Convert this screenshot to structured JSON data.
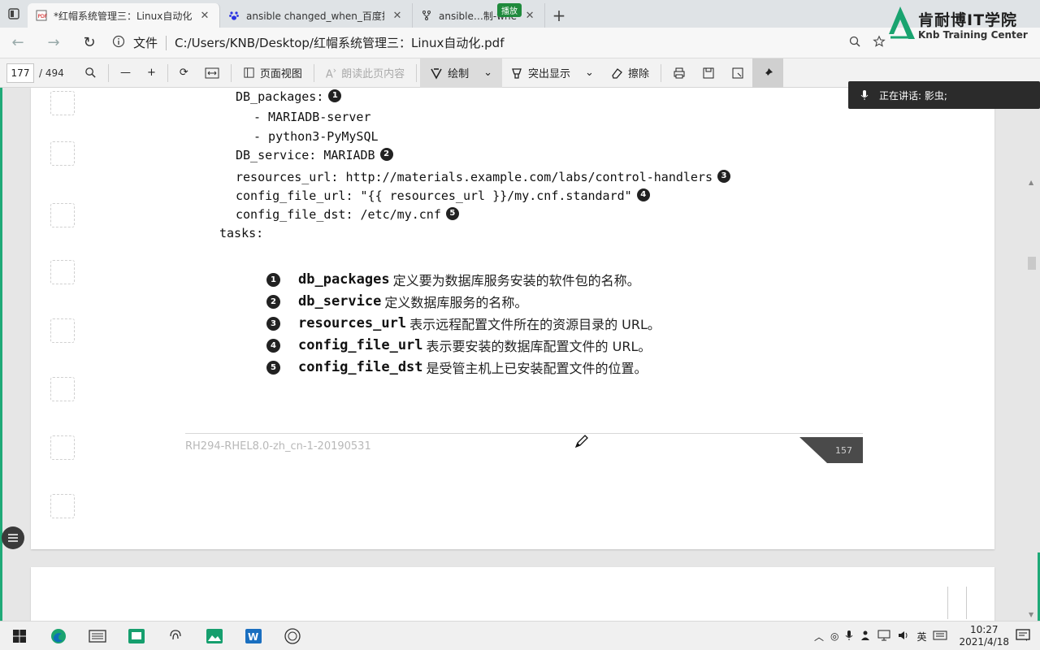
{
  "browser": {
    "tabs": [
      {
        "label": "*红帽系统管理三：Linux自动化.p",
        "active": true,
        "icon": "pdf-icon"
      },
      {
        "label": "ansible changed_when_百度搜索",
        "active": false,
        "icon": "baidu-paw-icon"
      },
      {
        "label": "ansible",
        "active": false,
        "icon": "git-fork-icon"
      }
    ],
    "tab3_suffix": "制-whe",
    "media_badge": "播放",
    "new_tab": "+",
    "address": {
      "file_label": "文件",
      "path": "C:/Users/KNB/Desktop/红帽系统管理三：Linux自动化.pdf"
    }
  },
  "watermark": {
    "cn": "肯耐博IT学院",
    "en": "Knb Training Center"
  },
  "pdf_toolbar": {
    "current_page": "177",
    "total_pages": "/ 494",
    "page_view": "页面视图",
    "read_aloud": "朗读此页内容",
    "draw": "绘制",
    "highlight": "突出显示",
    "erase": "擦除"
  },
  "speaking": {
    "label": "正在讲话: 影虫;"
  },
  "document": {
    "code_lines": [
      {
        "text": "DB_packages:",
        "indent": 1,
        "callout": "1"
      },
      {
        "text": "- MARIADB-server",
        "indent": 2,
        "callout": ""
      },
      {
        "text": "- python3-PyMySQL",
        "indent": 2,
        "callout": ""
      },
      {
        "text": "DB_service: MARIADB",
        "indent": 1,
        "callout": "2"
      },
      {
        "text": "resources_url: http://materials.example.com/labs/control-handlers",
        "indent": 1,
        "callout": "3"
      },
      {
        "text": "config_file_url: \"{{ resources_url }}/my.cnf.standard\"",
        "indent": 1,
        "callout": "4"
      },
      {
        "text": "config_file_dst: /etc/my.cnf",
        "indent": 1,
        "callout": "5"
      },
      {
        "text": "tasks:",
        "indent": 0,
        "callout": ""
      }
    ],
    "annotations": [
      {
        "num": "1",
        "term": "db_packages",
        "desc": "定义要为数据库服务安装的软件包的名称。"
      },
      {
        "num": "2",
        "term": "db_service",
        "desc": "定义数据库服务的名称。"
      },
      {
        "num": "3",
        "term": "resources_url",
        "desc": "表示远程配置文件所在的资源目录的 URL。"
      },
      {
        "num": "4",
        "term": "config_file_url",
        "desc": "表示要安装的数据库配置文件的 URL。"
      },
      {
        "num": "5",
        "term": "config_file_dst",
        "desc": "是受管主机上已安装配置文件的位置。"
      }
    ],
    "footer_text": "RH294-RHEL8.0-zh_cn-1-20190531",
    "page_number": "157"
  },
  "taskbar": {
    "ime": "英",
    "time": "10:27",
    "date": "2021/4/18"
  },
  "colors": {
    "accent_green": "#1faa78",
    "dark_callout": "#222222"
  }
}
